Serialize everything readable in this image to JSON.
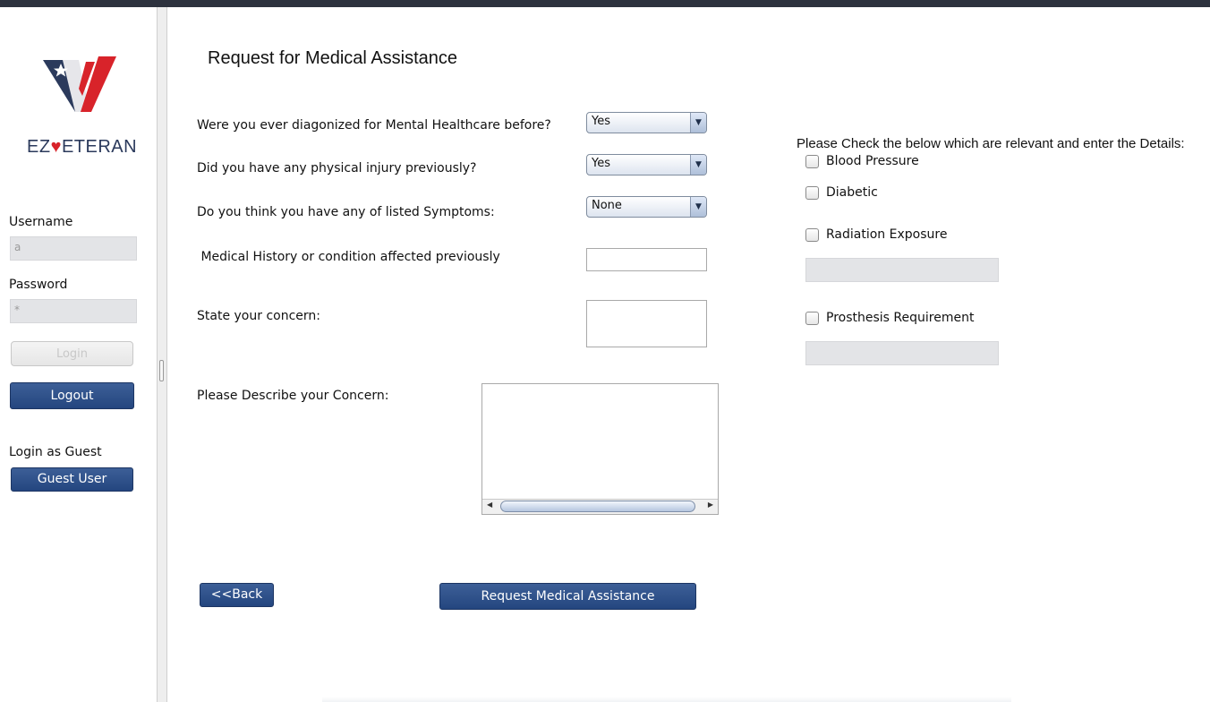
{
  "app": {
    "brand_text_prefix": "EZ",
    "brand_text_suffix": "ETERAN",
    "logo_icon": "veteran-flag-v-logo"
  },
  "sidebar": {
    "username_label": "Username",
    "username_value": "a",
    "password_label": "Password",
    "password_value": "*",
    "login_label": "Login",
    "logout_label": "Logout",
    "guest_heading": "Login as Guest",
    "guest_button_label": "Guest User"
  },
  "form": {
    "title": "Request for Medical Assistance",
    "q_mental": "Were you ever diagonized for Mental Healthcare before?",
    "q_mental_value": "Yes",
    "q_injury": "Did you have any physical injury previously?",
    "q_injury_value": "Yes",
    "q_symptoms": "Do you think you have any of listed Symptoms:",
    "q_symptoms_value": "None",
    "q_history": " Medical History or condition affected previously",
    "q_concern": "State your concern:",
    "q_describe": "Please Describe your Concern:",
    "back_label": "<<Back",
    "submit_label": "Request Medical Assistance"
  },
  "details": {
    "heading": "Please Check the below which are relevant and enter the Details:",
    "blood_pressure": "Blood Pressure",
    "diabetic": "Diabetic",
    "radiation": "Radiation Exposure",
    "prosthesis": "Prosthesis Requirement"
  },
  "colors": {
    "accent_blue": "#24467f",
    "topbar": "#2d323e",
    "logo_red": "#d8232a",
    "logo_navy": "#2b3a5c"
  }
}
